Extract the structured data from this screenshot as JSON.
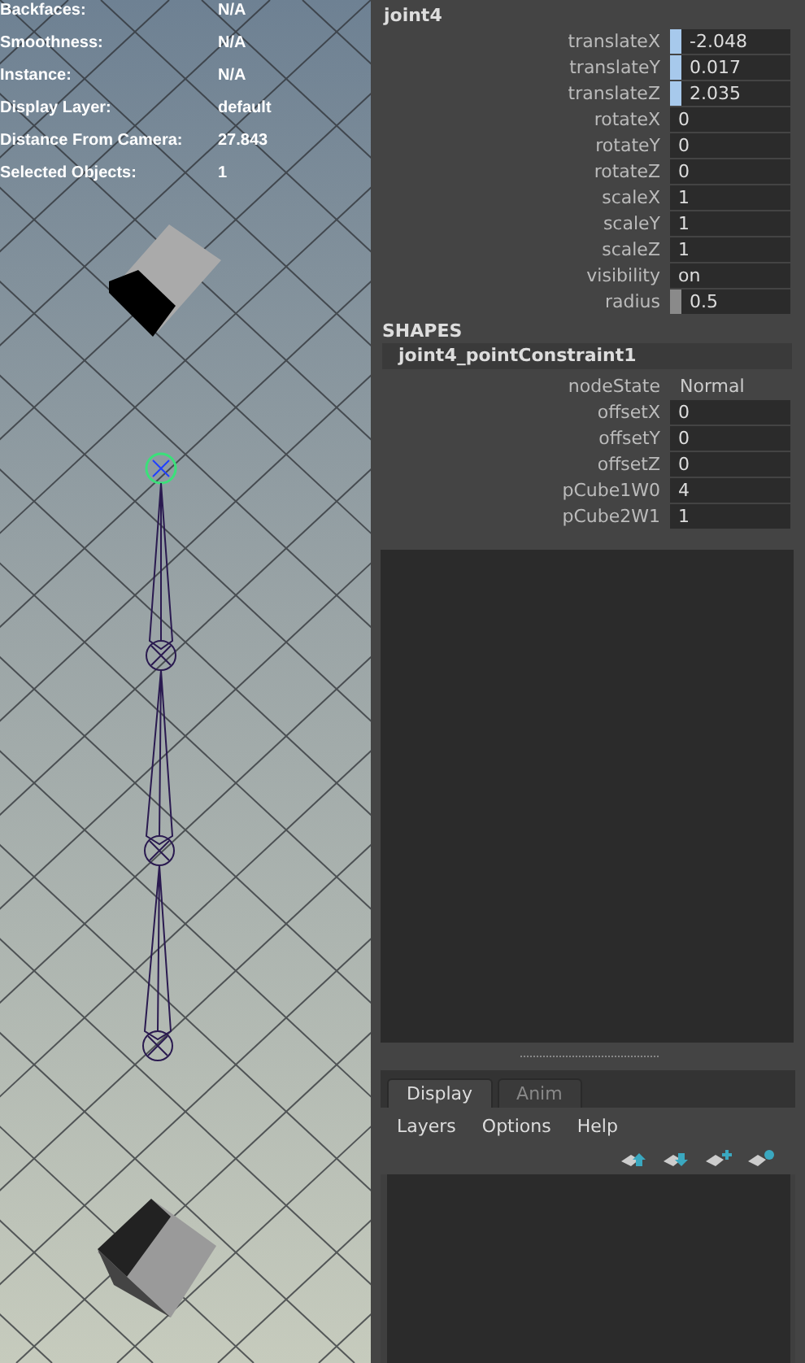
{
  "viewport": {
    "hud": [
      {
        "label": "Backfaces:",
        "value": "N/A"
      },
      {
        "label": "Smoothness:",
        "value": "N/A"
      },
      {
        "label": "Instance:",
        "value": "N/A"
      },
      {
        "label": "Display Layer:",
        "value": "default"
      },
      {
        "label": "Distance From Camera:",
        "value": "27.843"
      },
      {
        "label": "Selected Objects:",
        "value": "1"
      }
    ]
  },
  "attribute_editor": {
    "node": "joint4",
    "attributes": [
      {
        "name": "translateX",
        "value": "-2.048",
        "kind": "keyed"
      },
      {
        "name": "translateY",
        "value": "0.017",
        "kind": "keyed"
      },
      {
        "name": "translateZ",
        "value": "2.035",
        "kind": "keyed"
      },
      {
        "name": "rotateX",
        "value": "0",
        "kind": "plain"
      },
      {
        "name": "rotateY",
        "value": "0",
        "kind": "plain"
      },
      {
        "name": "rotateZ",
        "value": "0",
        "kind": "plain"
      },
      {
        "name": "scaleX",
        "value": "1",
        "kind": "plain"
      },
      {
        "name": "scaleY",
        "value": "1",
        "kind": "plain"
      },
      {
        "name": "scaleZ",
        "value": "1",
        "kind": "plain"
      },
      {
        "name": "visibility",
        "value": "on",
        "kind": "plain"
      },
      {
        "name": "radius",
        "value": "0.5",
        "kind": "marked"
      }
    ],
    "shapes": {
      "header": "SHAPES",
      "node": "joint4_pointConstraint1",
      "attributes": [
        {
          "name": "nodeState",
          "value": "Normal",
          "kind": "enum"
        },
        {
          "name": "offsetX",
          "value": "0",
          "kind": "plain"
        },
        {
          "name": "offsetY",
          "value": "0",
          "kind": "plain"
        },
        {
          "name": "offsetZ",
          "value": "0",
          "kind": "plain"
        },
        {
          "name": "pCube1W0",
          "value": "4",
          "kind": "plain"
        },
        {
          "name": "pCube2W1",
          "value": "1",
          "kind": "plain"
        }
      ]
    }
  },
  "layer_editor": {
    "tabs": [
      {
        "label": "Display",
        "selected": true
      },
      {
        "label": "Anim",
        "selected": false
      }
    ],
    "menu": [
      "Layers",
      "Options",
      "Help"
    ]
  }
}
